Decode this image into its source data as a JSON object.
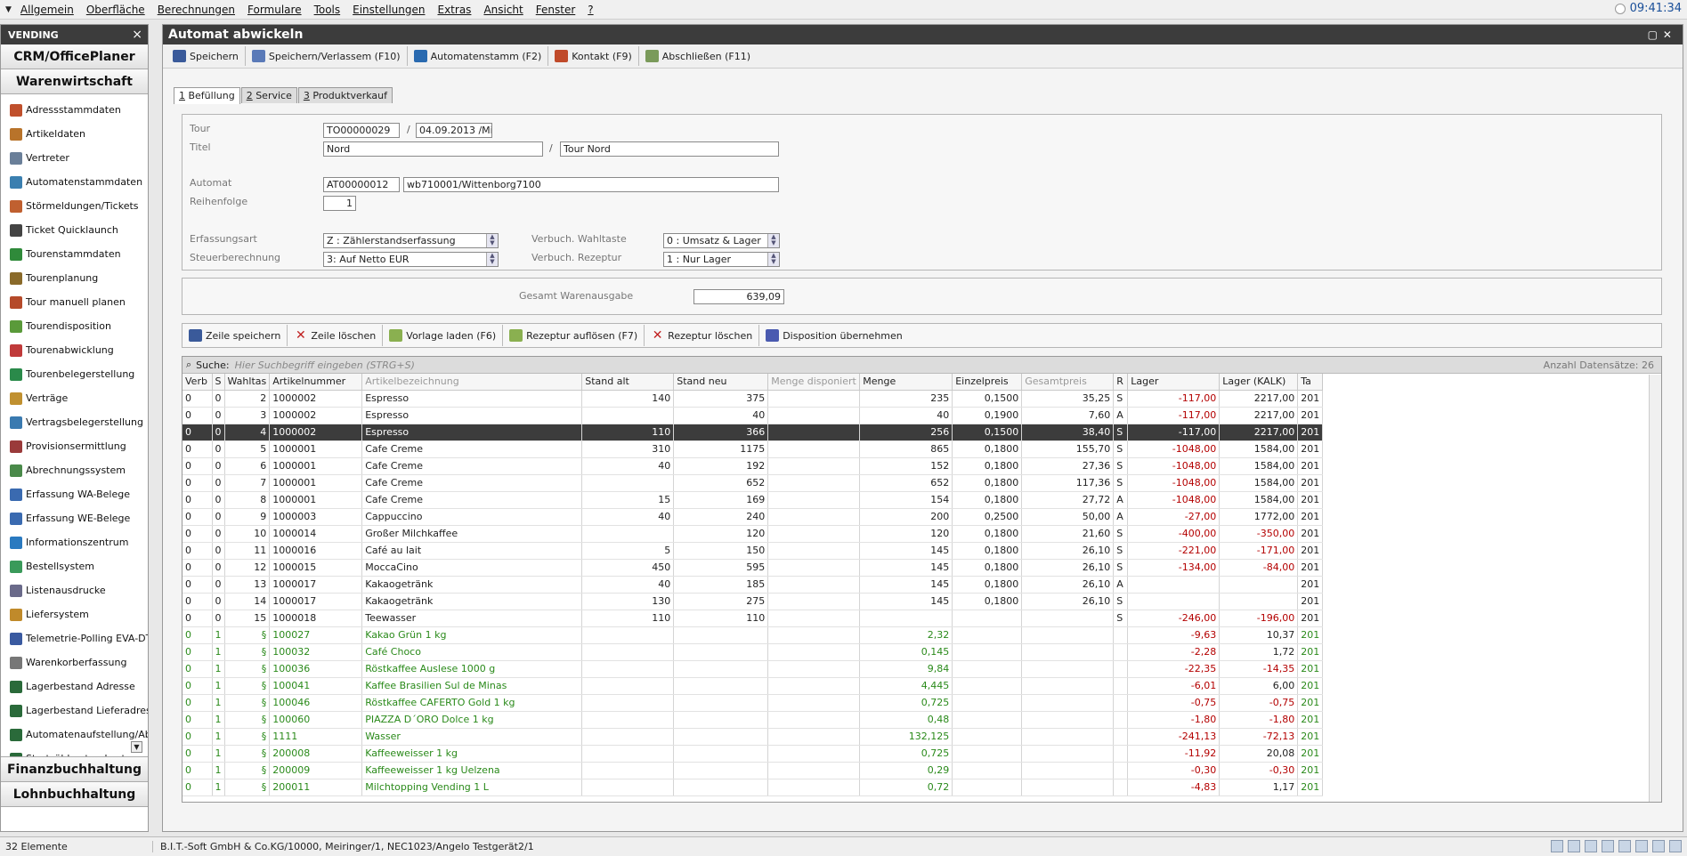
{
  "menubar": {
    "items": [
      "Allgemein",
      "Oberfläche",
      "Berechnungen",
      "Formulare",
      "Tools",
      "Einstellungen",
      "Extras",
      "Ansicht",
      "Fenster",
      "?"
    ],
    "clock": "09:41:34"
  },
  "sidebar": {
    "title": "VENDING",
    "close": "×",
    "modules_top": [
      "CRM/OfficePlaner",
      "Warenwirtschaft"
    ],
    "items": [
      {
        "label": "Adressstammdaten",
        "icon": "address-book-icon",
        "color": "#c0502c"
      },
      {
        "label": "Artikeldaten",
        "icon": "article-icon",
        "color": "#b8732a"
      },
      {
        "label": "Vertreter",
        "icon": "representative-icon",
        "color": "#6a7f99"
      },
      {
        "label": "Automatenstammdaten",
        "icon": "vending-machine-icon",
        "color": "#3b7fb0"
      },
      {
        "label": "Störmeldungen/Tickets",
        "icon": "ticket-icon",
        "color": "#c06030"
      },
      {
        "label": "Ticket Quicklaunch",
        "icon": "quicklaunch-icon",
        "color": "#444"
      },
      {
        "label": "Tourenstammdaten",
        "icon": "tour-master-icon",
        "color": "#2f8a3a"
      },
      {
        "label": "Tourenplanung",
        "icon": "tour-planning-icon",
        "color": "#8a6a2a"
      },
      {
        "label": "Tour manuell planen",
        "icon": "manual-plan-icon",
        "color": "#b54a2a"
      },
      {
        "label": "Tourendisposition",
        "icon": "disposition-icon",
        "color": "#5a9a3a"
      },
      {
        "label": "Tourenabwicklung",
        "icon": "tour-processing-icon",
        "color": "#c03a3a"
      },
      {
        "label": "Tourenbelegerstellung",
        "icon": "tour-document-icon",
        "color": "#2a8a4a"
      },
      {
        "label": "Verträge",
        "icon": "contract-icon",
        "color": "#c09030"
      },
      {
        "label": "Vertragsbelegerstellung",
        "icon": "contract-document-icon",
        "color": "#3a7ab0"
      },
      {
        "label": "Provisionsermittlung",
        "icon": "commission-icon",
        "color": "#9a3a3a"
      },
      {
        "label": "Abrechnungssystem",
        "icon": "billing-icon",
        "color": "#4a8a4a"
      },
      {
        "label": "Erfassung WA-Belege",
        "icon": "wa-voucher-icon",
        "color": "#3a6ab0"
      },
      {
        "label": "Erfassung WE-Belege",
        "icon": "we-voucher-icon",
        "color": "#3a6ab0"
      },
      {
        "label": "Informationszentrum",
        "icon": "info-center-icon",
        "color": "#2a7ac0"
      },
      {
        "label": "Bestellsystem",
        "icon": "order-system-icon",
        "color": "#3a9a5a"
      },
      {
        "label": "Listenausdrucke",
        "icon": "print-list-icon",
        "color": "#6a6a8a"
      },
      {
        "label": "Liefersystem",
        "icon": "delivery-icon",
        "color": "#c08a2a"
      },
      {
        "label": "Telemetrie-Polling EVA-DTS",
        "icon": "telemetry-icon",
        "color": "#3a5aa0"
      },
      {
        "label": "Warenkorberfassung",
        "icon": "cart-icon",
        "color": "#777"
      },
      {
        "label": "Lagerbestand Adresse",
        "icon": "eye-icon",
        "color": "#2a6a3a"
      },
      {
        "label": "Lagerbestand Lieferadress",
        "icon": "eye-icon",
        "color": "#2a6a3a"
      },
      {
        "label": "Automatenaufstellung/Abh",
        "icon": "eye-icon",
        "color": "#2a6a3a"
      },
      {
        "label": "Startzählerstand setzen",
        "icon": "eye-icon",
        "color": "#2a6a3a"
      }
    ],
    "modules_bottom": [
      "Finanzbuchhaltung",
      "Lohnbuchhaltung"
    ]
  },
  "window": {
    "title": "Automat abwickeln",
    "toolbar": [
      "Speichern",
      "Speichern/Verlassem (F10)",
      "Automatenstamm (F2)",
      "Kontakt (F9)",
      "Abschließen (F11)"
    ],
    "tabs": [
      {
        "num": "1",
        "label": " Befüllung"
      },
      {
        "num": "2",
        "label": " Service"
      },
      {
        "num": "3",
        "label": " Produktverkauf"
      }
    ]
  },
  "form": {
    "tour_label": "Tour",
    "tour_no": "TO00000029",
    "tour_date": "04.09.2013 /Mi",
    "titel_label": "Titel",
    "titel": "Nord",
    "titel2": "Tour Nord",
    "automat_label": "Automat",
    "automat_no": "AT00000012",
    "automat_name": "wb710001/Wittenborg7100",
    "reihenfolge_label": "Reihenfolge",
    "reihenfolge": "1",
    "erfassungsart_label": "Erfassungsart",
    "erfassungsart": "Z : Zählerstandserfassung",
    "steuer_label": "Steuerberechnung",
    "steuer": "3: Auf Netto EUR",
    "wahltaste_label": "Verbuch. Wahltaste",
    "wahltaste": "0 : Umsatz & Lager",
    "rezeptur_label": "Verbuch. Rezeptur",
    "rezeptur": "1 : Nur Lager",
    "slash": "/"
  },
  "summary": {
    "label": "Gesamt Warenausgabe",
    "value": "639,09"
  },
  "grid_toolbar": [
    "Zeile speichern",
    "Zeile löschen",
    "Vorlage laden (F6)",
    "Rezeptur auflösen (F7)",
    "Rezeptur löschen",
    "Disposition übernehmen"
  ],
  "grid": {
    "search_label": "Suche:",
    "search_placeholder": "Hier Suchbegriff eingeben (STRG+S)",
    "count": "Anzahl Datensätze: 26",
    "columns": [
      "Verb",
      "S",
      "Wahltas",
      "Artikelnummer",
      "Artikelbezeichnung",
      "Stand alt",
      "Stand neu",
      "Menge disponiert",
      "Menge",
      "Einzelpreis",
      "Gesamtpreis",
      "R",
      "Lager",
      "Lager (KALK)",
      "Ta"
    ],
    "rows": [
      [
        "0",
        "0",
        "2",
        "1000002",
        "Espresso",
        "140",
        "375",
        "",
        "235",
        "0,1500",
        "35,25",
        "S",
        "-117,00",
        "2217,00",
        "201"
      ],
      [
        "0",
        "0",
        "3",
        "1000002",
        "Espresso",
        "",
        "40",
        "",
        "40",
        "0,1900",
        "7,60",
        "A",
        "-117,00",
        "2217,00",
        "201"
      ],
      [
        "0",
        "0",
        "4",
        "1000002",
        "Espresso",
        "110",
        "366",
        "",
        "256",
        "0,1500",
        "38,40",
        "S",
        "-117,00",
        "2217,00",
        "201"
      ],
      [
        "0",
        "0",
        "5",
        "1000001",
        "Cafe Creme",
        "310",
        "1175",
        "",
        "865",
        "0,1800",
        "155,70",
        "S",
        "-1048,00",
        "1584,00",
        "201"
      ],
      [
        "0",
        "0",
        "6",
        "1000001",
        "Cafe Creme",
        "40",
        "192",
        "",
        "152",
        "0,1800",
        "27,36",
        "S",
        "-1048,00",
        "1584,00",
        "201"
      ],
      [
        "0",
        "0",
        "7",
        "1000001",
        "Cafe Creme",
        "",
        "652",
        "",
        "652",
        "0,1800",
        "117,36",
        "S",
        "-1048,00",
        "1584,00",
        "201"
      ],
      [
        "0",
        "0",
        "8",
        "1000001",
        "Cafe Creme",
        "15",
        "169",
        "",
        "154",
        "0,1800",
        "27,72",
        "A",
        "-1048,00",
        "1584,00",
        "201"
      ],
      [
        "0",
        "0",
        "9",
        "1000003",
        "Cappuccino",
        "40",
        "240",
        "",
        "200",
        "0,2500",
        "50,00",
        "A",
        "-27,00",
        "1772,00",
        "201"
      ],
      [
        "0",
        "0",
        "10",
        "1000014",
        "Großer Milchkaffee",
        "",
        "120",
        "",
        "120",
        "0,1800",
        "21,60",
        "S",
        "-400,00",
        "-350,00",
        "201"
      ],
      [
        "0",
        "0",
        "11",
        "1000016",
        "Café au lait",
        "5",
        "150",
        "",
        "145",
        "0,1800",
        "26,10",
        "S",
        "-221,00",
        "-171,00",
        "201"
      ],
      [
        "0",
        "0",
        "12",
        "1000015",
        "MoccaCino",
        "450",
        "595",
        "",
        "145",
        "0,1800",
        "26,10",
        "S",
        "-134,00",
        "-84,00",
        "201"
      ],
      [
        "0",
        "0",
        "13",
        "1000017",
        "Kakaogetränk",
        "40",
        "185",
        "",
        "145",
        "0,1800",
        "26,10",
        "A",
        "",
        "",
        "201"
      ],
      [
        "0",
        "0",
        "14",
        "1000017",
        "Kakaogetränk",
        "130",
        "275",
        "",
        "145",
        "0,1800",
        "26,10",
        "S",
        "",
        "",
        "201"
      ],
      [
        "0",
        "0",
        "15",
        "1000018",
        "Teewasser",
        "110",
        "110",
        "",
        "",
        "",
        "",
        "S",
        "-246,00",
        "-196,00",
        "201"
      ],
      [
        "0",
        "1",
        "§",
        "100027",
        "Kakao Grün 1 kg",
        "",
        "",
        "",
        "2,32",
        "",
        "",
        "",
        "-9,63",
        "10,37",
        "201"
      ],
      [
        "0",
        "1",
        "§",
        "100032",
        "Café Choco",
        "",
        "",
        "",
        "0,145",
        "",
        "",
        "",
        "-2,28",
        "1,72",
        "201"
      ],
      [
        "0",
        "1",
        "§",
        "100036",
        "Röstkaffee Auslese 1000 g",
        "",
        "",
        "",
        "9,84",
        "",
        "",
        "",
        "-22,35",
        "-14,35",
        "201"
      ],
      [
        "0",
        "1",
        "§",
        "100041",
        "Kaffee Brasilien Sul de Minas",
        "",
        "",
        "",
        "4,445",
        "",
        "",
        "",
        "-6,01",
        "6,00",
        "201"
      ],
      [
        "0",
        "1",
        "§",
        "100046",
        "Röstkaffee CAFERTO Gold 1 kg",
        "",
        "",
        "",
        "0,725",
        "",
        "",
        "",
        "-0,75",
        "-0,75",
        "201"
      ],
      [
        "0",
        "1",
        "§",
        "100060",
        "PIAZZA D´ORO Dolce 1 kg",
        "",
        "",
        "",
        "0,48",
        "",
        "",
        "",
        "-1,80",
        "-1,80",
        "201"
      ],
      [
        "0",
        "1",
        "§",
        "1111",
        "Wasser",
        "",
        "",
        "",
        "132,125",
        "",
        "",
        "",
        "-241,13",
        "-72,13",
        "201"
      ],
      [
        "0",
        "1",
        "§",
        "200008",
        "Kaffeeweisser 1 kg",
        "",
        "",
        "",
        "0,725",
        "",
        "",
        "",
        "-11,92",
        "20,08",
        "201"
      ],
      [
        "0",
        "1",
        "§",
        "200009",
        "Kaffeeweisser 1 kg Uelzena",
        "",
        "",
        "",
        "0,29",
        "",
        "",
        "",
        "-0,30",
        "-0,30",
        "201"
      ],
      [
        "0",
        "1",
        "§",
        "200011",
        "Milchtopping Vending 1 L",
        "",
        "",
        "",
        "0,72",
        "",
        "",
        "",
        "-4,83",
        "1,17",
        "201"
      ]
    ],
    "selected_row": 2
  },
  "statusbar": {
    "count": "32 Elemente",
    "info": "B.I.T.-Soft GmbH & Co.KG/10000, Meiringer/1, NEC1023/Angelo Testgerät2/1"
  }
}
